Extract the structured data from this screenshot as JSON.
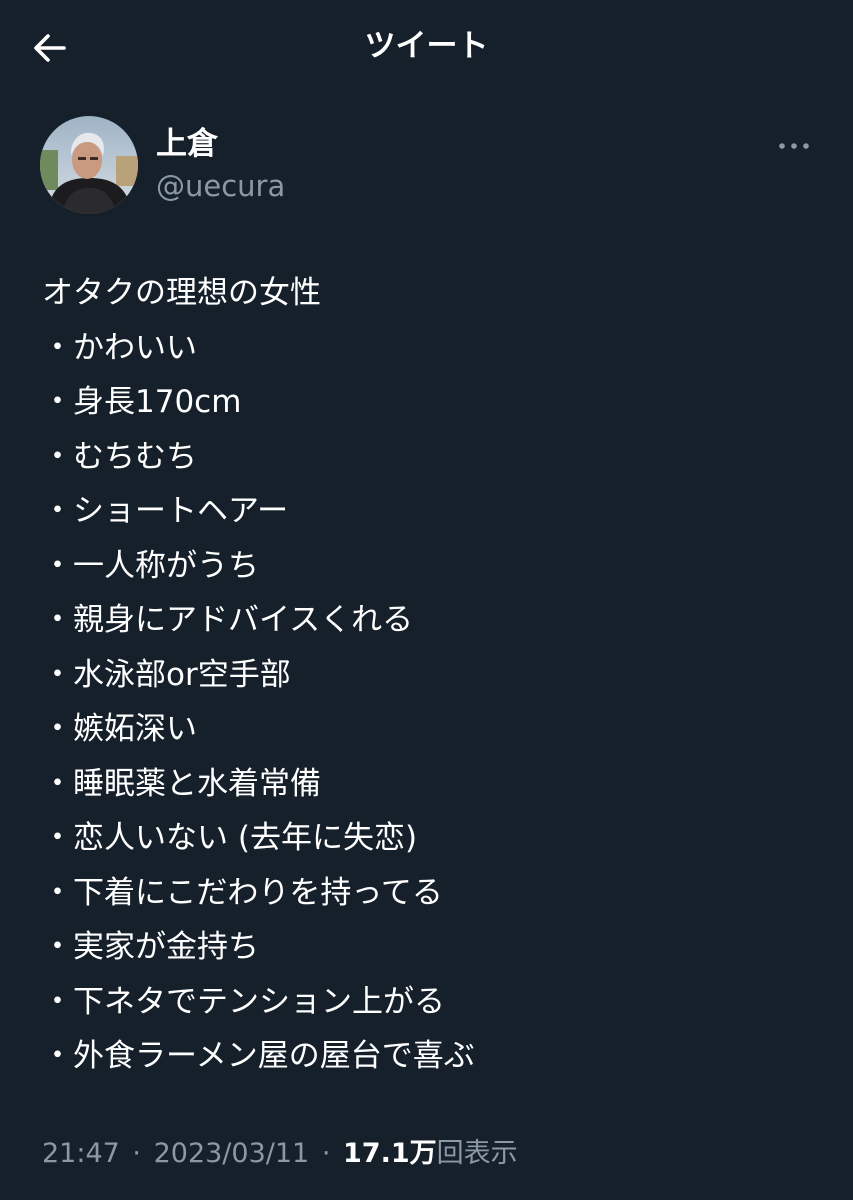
{
  "header": {
    "title": "ツイート"
  },
  "author": {
    "display_name": "上倉",
    "handle": "@uecura"
  },
  "tweet": {
    "lines": [
      "オタクの理想の女性",
      "・かわいい",
      "・身長170cm",
      "・むちむち",
      "・ショートヘアー",
      "・一人称がうち",
      "・親身にアドバイスくれる",
      "・水泳部or空手部",
      "・嫉妬深い",
      "・睡眠薬と水着常備",
      "・恋人いない (去年に失恋)",
      "・下着にこだわりを持ってる",
      "・実家が金持ち",
      "・下ネタでテンション上がる",
      "・外食ラーメン屋の屋台で喜ぶ"
    ]
  },
  "meta": {
    "time": "21:47",
    "separator": "·",
    "date": "2023/03/11",
    "views_count": "17.1万",
    "views_label": "回表示"
  },
  "icons": {
    "back": "back-arrow-icon",
    "more": "more-horizontal-icon"
  },
  "colors": {
    "background": "#15202b",
    "primary_text": "#ffffff",
    "secondary_text": "#8b98a5"
  }
}
